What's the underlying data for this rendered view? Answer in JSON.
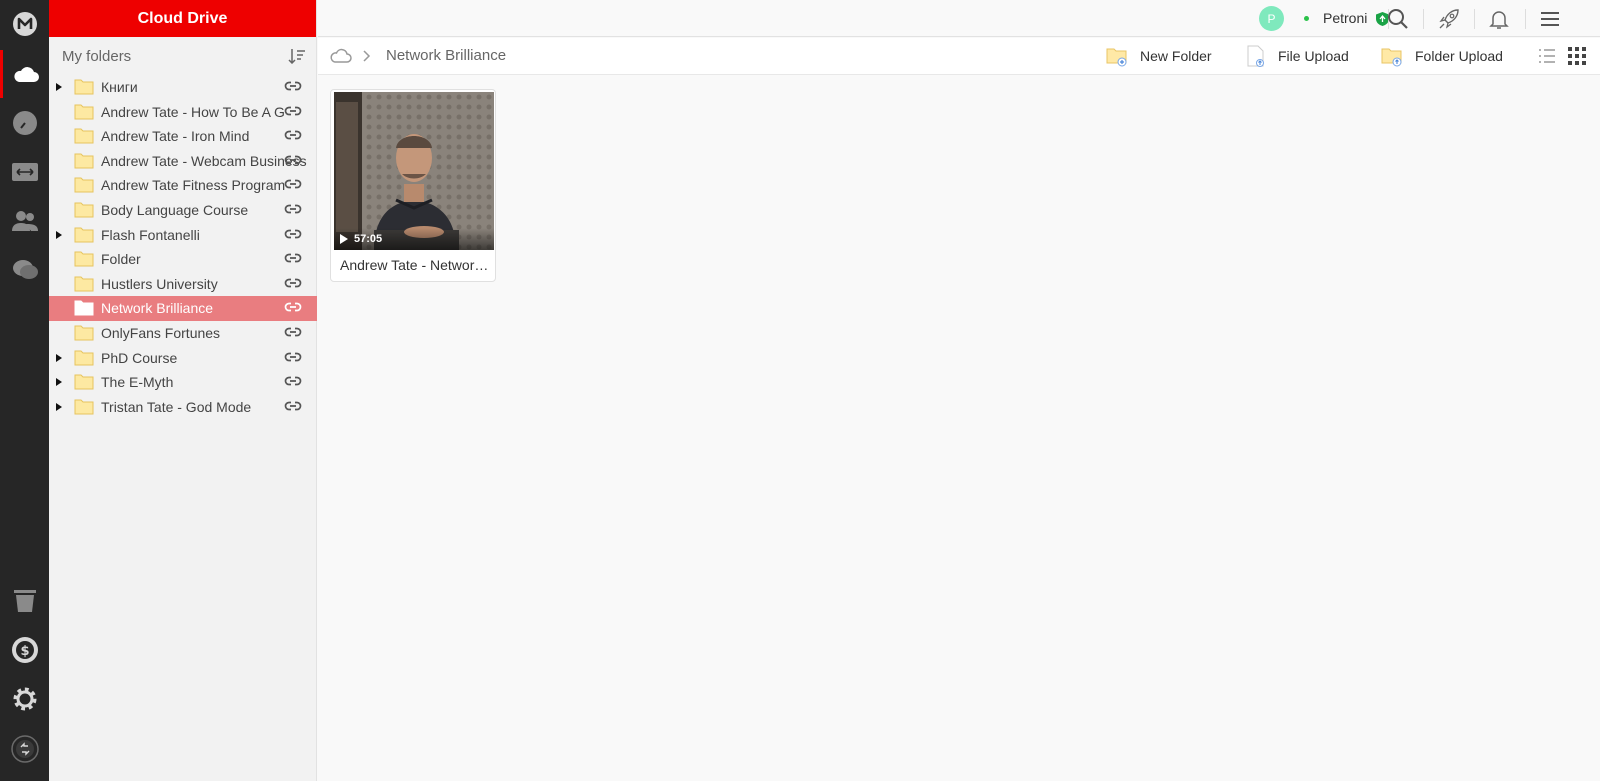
{
  "app": {
    "title": "Cloud Drive"
  },
  "tree": {
    "heading": "My folders",
    "items": [
      {
        "label": "Книги",
        "expandable": true
      },
      {
        "label": "Andrew Tate - How To Be A G",
        "expandable": false
      },
      {
        "label": "Andrew Tate - Iron Mind",
        "expandable": false
      },
      {
        "label": "Andrew Tate - Webcam Business",
        "expandable": false
      },
      {
        "label": "Andrew Tate Fitness Program",
        "expandable": false
      },
      {
        "label": "Body Language Course",
        "expandable": false
      },
      {
        "label": "Flash Fontanelli",
        "expandable": true
      },
      {
        "label": "Folder",
        "expandable": false
      },
      {
        "label": "Hustlers University",
        "expandable": false
      },
      {
        "label": "Network Brilliance",
        "expandable": false,
        "selected": true
      },
      {
        "label": "OnlyFans Fortunes",
        "expandable": false
      },
      {
        "label": "PhD Course",
        "expandable": true
      },
      {
        "label": "The E-Myth",
        "expandable": true
      },
      {
        "label": "Tristan Tate - God Mode",
        "expandable": true
      }
    ]
  },
  "topbar": {
    "avatar_initial": "P",
    "username": "Petroni"
  },
  "breadcrumb": {
    "current": "Network Brilliance"
  },
  "toolbar": {
    "new_folder": "New Folder",
    "file_upload": "File Upload",
    "folder_upload": "Folder Upload"
  },
  "files": [
    {
      "name": "Andrew Tate - Network Brilliance",
      "duration": "57:05",
      "type": "video"
    }
  ],
  "colors": {
    "brand": "#e00000",
    "selected_row": "#e97d80",
    "rail": "#262626",
    "avatar": "#7fe9bd"
  },
  "icons": {
    "rail": [
      "mega-logo-icon",
      "cloud-icon",
      "recents-icon",
      "transfers-icon",
      "contacts-icon",
      "chat-icon",
      "rubbish-bin-icon",
      "pro-plan-icon",
      "settings-icon",
      "sync-icon"
    ],
    "topbar": [
      "search-icon",
      "rocket-icon",
      "bell-icon",
      "menu-icon"
    ]
  }
}
